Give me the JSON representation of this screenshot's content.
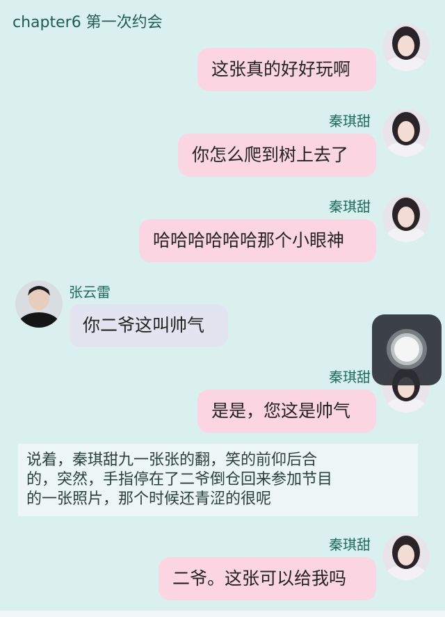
{
  "header": {
    "title": "chapter6 第一次约会"
  },
  "messages": [
    {
      "sender": "",
      "text": "这张真的好好玩啊",
      "side": "right"
    },
    {
      "sender": "秦琪甜",
      "text": "你怎么爬到树上去了",
      "side": "right"
    },
    {
      "sender": "秦琪甜",
      "text": "哈哈哈哈哈哈那个小眼神",
      "side": "right"
    },
    {
      "sender": "张云雷",
      "text": "你二爷这叫帅气",
      "side": "left"
    },
    {
      "sender": "秦琪甜",
      "text": "是是，您这是帅气",
      "side": "right"
    },
    {
      "sender": "秦琪甜",
      "text": "二爷。这张可以给我吗",
      "side": "right"
    }
  ],
  "narration": {
    "lines": [
      "说着，秦琪甜九一张张的翻，笑的前仰后合",
      "的，突然，手指停在了二爷倒仓回来参加节目",
      "的一张照片，那个时候还青涩的很呢"
    ]
  },
  "colors": {
    "background": "#daf0ee",
    "sender_name": "#1f6b5c",
    "bubble_right": "#fbd6e2",
    "bubble_left": "#e2e5ef"
  },
  "icons": {
    "assistive_touch": "assistive-touch-icon"
  }
}
